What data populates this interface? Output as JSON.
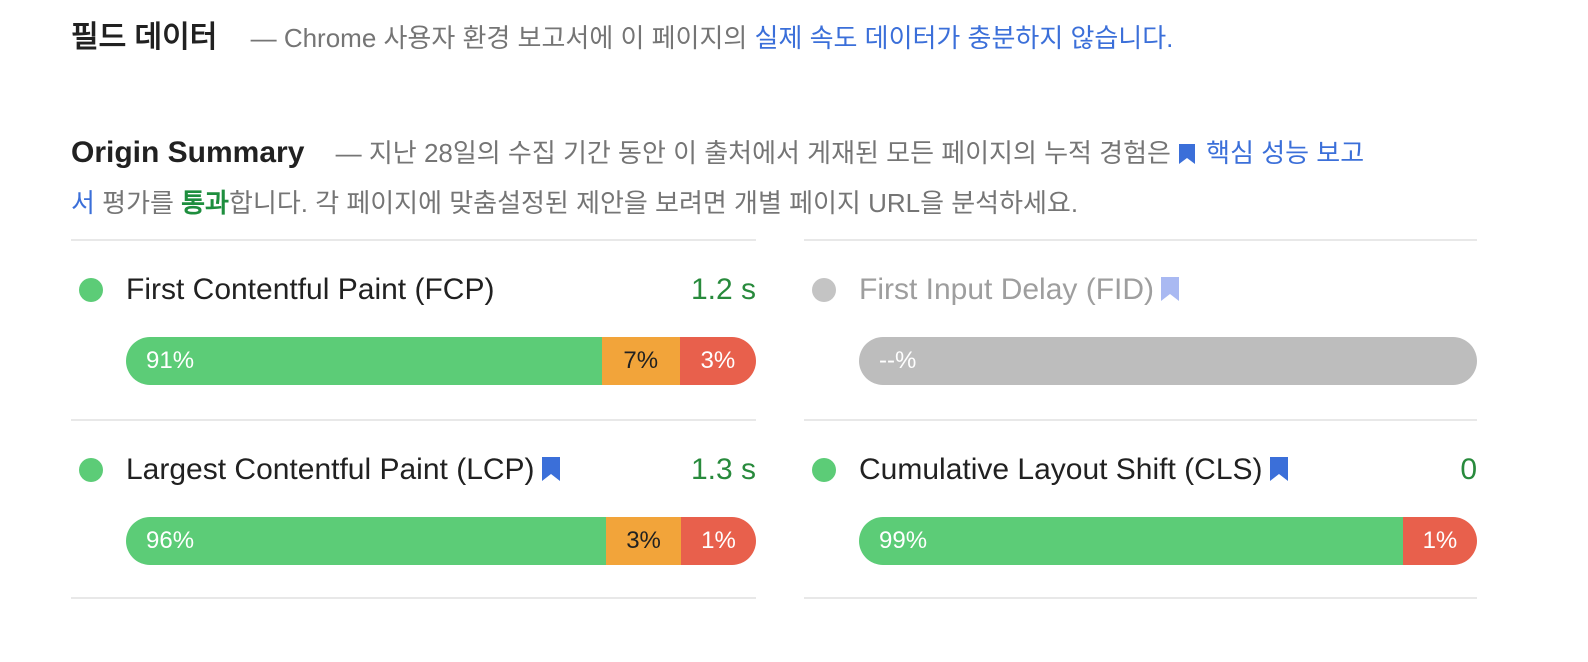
{
  "field_data": {
    "title": "필드 데이터",
    "dash": "—",
    "desc_prefix": "Chrome 사용자 환경 보고서에 이 페이지의",
    "desc_link": "실제 속도 데이터가 충분하지 않습니다."
  },
  "origin_summary": {
    "title": "Origin Summary",
    "dash": "—",
    "desc_1": "지난 28일의 수집 기간 동안 이 출처에서 게재된 모든 페이지의 누적 경험은",
    "link_text": "핵심 성능 보고서",
    "desc_2": " 평가를",
    "pass_text": "통과",
    "desc_3": "합니다. 각 페이지에 맞춤설정된 제안을 보려면 개별 페이지 URL을 분석하세요."
  },
  "colors": {
    "good": "#5ccc77",
    "average": "#f2a43a",
    "poor": "#e8604c",
    "no_data": "#bdbdbd",
    "link": "#3b6fd9",
    "pass_value": "#288a3c"
  },
  "metrics": {
    "fcp": {
      "name": "First Contentful Paint (FCP)",
      "value": "1.2 s",
      "status": "good",
      "bookmark": false,
      "good_pct": 91,
      "avg_pct": 7,
      "poor_pct": 3,
      "good_label": "91%",
      "avg_label": "7%",
      "poor_label": "3%"
    },
    "fid": {
      "name": "First Input Delay (FID)",
      "value": "",
      "status": "no-data",
      "bookmark": true,
      "bar_label": "--%"
    },
    "lcp": {
      "name": "Largest Contentful Paint (LCP)",
      "value": "1.3 s",
      "status": "good",
      "bookmark": true,
      "good_pct": 96,
      "avg_pct": 3,
      "poor_pct": 1,
      "good_label": "96%",
      "avg_label": "3%",
      "poor_label": "1%"
    },
    "cls": {
      "name": "Cumulative Layout Shift (CLS)",
      "value": "0",
      "status": "good",
      "bookmark": true,
      "good_pct": 99,
      "avg_pct": 0,
      "poor_pct": 1,
      "good_label": "99%",
      "poor_label": "1%"
    }
  }
}
